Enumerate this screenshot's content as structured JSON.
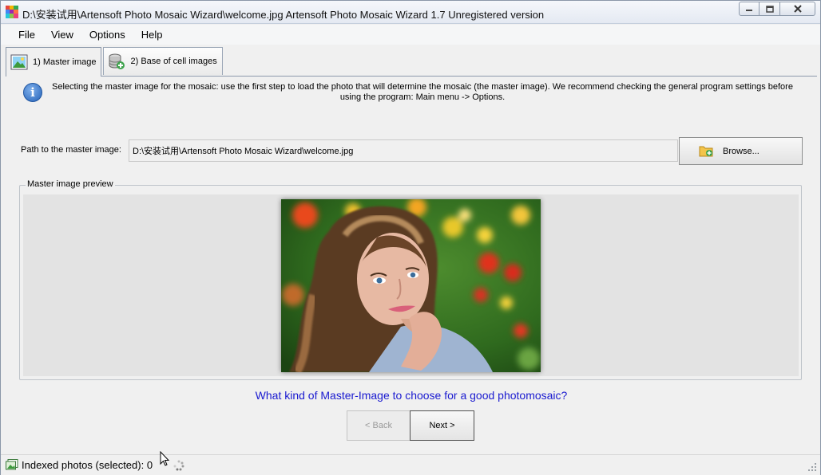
{
  "window": {
    "title": "D:\\安装试用\\Artensoft Photo Mosaic Wizard\\welcome.jpg Artensoft Photo Mosaic Wizard 1.7  Unregistered version",
    "minimize_icon": "minimize-icon",
    "maximize_icon": "maximize-icon",
    "close_icon": "close-icon"
  },
  "menu": [
    "File",
    "View",
    "Options",
    "Help"
  ],
  "tabs": [
    {
      "label": "1) Master image",
      "icon": "image-icon",
      "active": true
    },
    {
      "label": "2) Base of cell images",
      "icon": "database-add-icon",
      "active": false
    }
  ],
  "info": {
    "icon": "info-icon",
    "text": "Selecting the master image for the mosaic: use the first step to load the photo that will determine the mosaic (the master image). We recommend checking the general program settings before using the program: Main menu -> Options."
  },
  "path": {
    "label": "Path to the master image:",
    "value": "D:\\安装试用\\Artensoft Photo Mosaic Wizard\\welcome.jpg"
  },
  "browse": {
    "label": "Browse...",
    "icon": "folder-add-icon"
  },
  "preview": {
    "legend": "Master image preview"
  },
  "help_link": "What kind of Master-Image to choose for a good photomosaic?",
  "nav": {
    "back": "< Back",
    "next": "Next >",
    "back_enabled": false
  },
  "status": {
    "text": "Indexed photos (selected): 0"
  },
  "colors": {
    "link": "#1a1ad0",
    "window_bg": "#f0f0f0",
    "preview_bg": "#e3e3e3"
  }
}
